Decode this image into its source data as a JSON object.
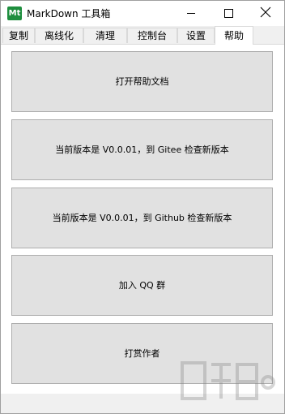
{
  "window": {
    "title": "MarkDown 工具箱",
    "icon_text": "Mt"
  },
  "tabs": [
    {
      "label": "复制"
    },
    {
      "label": "离线化"
    },
    {
      "label": "清理"
    },
    {
      "label": "控制台"
    },
    {
      "label": "设置"
    },
    {
      "label": "帮助"
    }
  ],
  "active_tab": "帮助",
  "buttons": {
    "open_help": "打开帮助文档",
    "gitee_version": "当前版本是 V0.0.01，到 Gitee 检查新版本",
    "github_version": "当前版本是 V0.0.01，到 Github 检查新版本",
    "join_qq": "加入 QQ 群",
    "donate": "打赏作者"
  },
  "colors": {
    "app_icon": "#1e8e3e",
    "button_face": "#e1e1e1",
    "tab_bar": "#f0f0f0"
  }
}
